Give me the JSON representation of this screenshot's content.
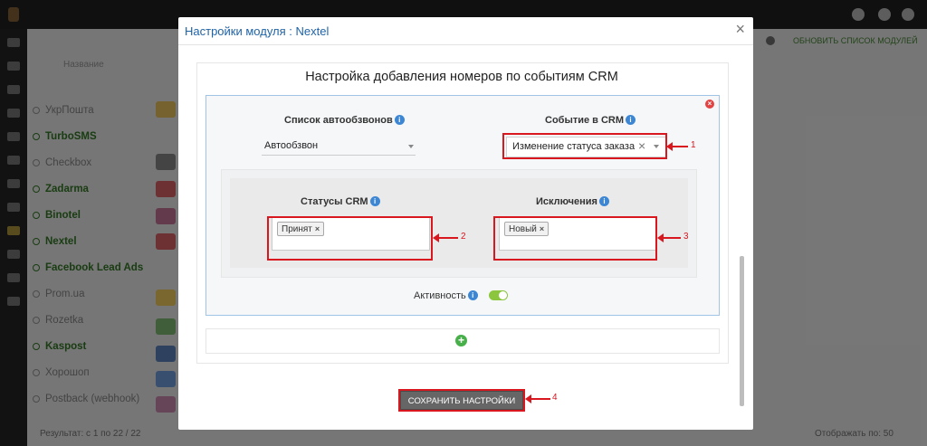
{
  "background": {
    "column_header": "Название",
    "modules": [
      {
        "label": "УкрПошта",
        "active": false
      },
      {
        "label": "TurboSMS",
        "active": true
      },
      {
        "label": "Checkbox",
        "active": false
      },
      {
        "label": "Zadarma",
        "active": true
      },
      {
        "label": "Binotel",
        "active": true
      },
      {
        "label": "Nextel",
        "active": true
      },
      {
        "label": "Facebook Lead Ads",
        "active": true
      },
      {
        "label": "Prom.ua",
        "active": false
      },
      {
        "label": "Rozetka",
        "active": false
      },
      {
        "label": "Kaspost",
        "active": true
      },
      {
        "label": "Хорошоп",
        "active": false
      },
      {
        "label": "Postback (webhook)",
        "active": false
      }
    ],
    "refresh_label": "ОБНОВИТЬ СПИСОК МОДУЛЕЙ",
    "footer_left": "Результат: с 1 по 22 / 22",
    "footer_right": "Отображать по: 50"
  },
  "modal": {
    "title": "Настройки модуля : Nextel",
    "close_glyph": "×",
    "section_title": "Настройка добавления номеров по событиям CRM",
    "remove_rule_glyph": "×",
    "info_glyph": "i",
    "autocall_list": {
      "label": "Список автообзвонов",
      "value": "Автообзвон"
    },
    "crm_event": {
      "label": "Событие в CRM",
      "value": "Изменение статуса заказа",
      "clear_glyph": "×"
    },
    "crm_statuses": {
      "label": "Статусы CRM",
      "tags": [
        "Принят"
      ]
    },
    "exclusions": {
      "label": "Исключения",
      "tags": [
        "Новый"
      ]
    },
    "tag_remove_glyph": "×",
    "activity": {
      "label": "Активность",
      "enabled": true
    },
    "add_glyph": "+",
    "save_label": "СОХРАНИТЬ НАСТРОЙКИ"
  },
  "annotations": {
    "n1": "1",
    "n2": "2",
    "n3": "3",
    "n4": "4"
  },
  "colors": {
    "accent": "#1f63a7",
    "annotation_red": "#d9171f",
    "toggle_on": "#8cc63f",
    "add": "#48b04a",
    "info": "#3c86d4"
  }
}
